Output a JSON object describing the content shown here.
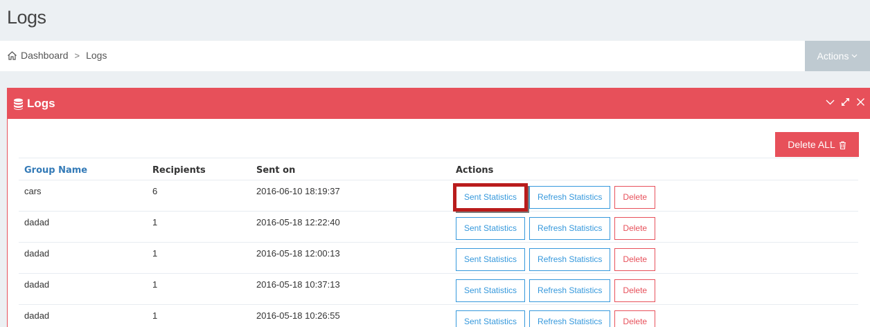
{
  "page": {
    "title": "Logs"
  },
  "breadcrumb": {
    "items": [
      "Dashboard",
      "Logs"
    ],
    "separator": ">"
  },
  "header_actions": {
    "label": "Actions"
  },
  "panel": {
    "title": "Logs",
    "color": "#e7505a"
  },
  "toolbar": {
    "delete_all_label": "Delete ALL"
  },
  "table": {
    "columns": [
      "Group Name",
      "Recipients",
      "Sent on",
      "Actions"
    ],
    "rows": [
      {
        "group": "cars",
        "recipients": "6",
        "sent_on": "2016-06-10 18:19:37"
      },
      {
        "group": "dadad",
        "recipients": "1",
        "sent_on": "2016-05-18 12:22:40"
      },
      {
        "group": "dadad",
        "recipients": "1",
        "sent_on": "2016-05-18 12:00:13"
      },
      {
        "group": "dadad",
        "recipients": "1",
        "sent_on": "2016-05-18 10:37:13"
      },
      {
        "group": "dadad",
        "recipients": "1",
        "sent_on": "2016-05-18 10:26:55"
      }
    ],
    "row_actions": {
      "sent": "Sent Statistics",
      "refresh": "Refresh Statistics",
      "delete": "Delete"
    }
  },
  "colors": {
    "accent": "#e7505a",
    "link": "#3598dc",
    "highlight": "#b91c1c"
  },
  "icons": [
    "home-icon",
    "database-icon",
    "chevron-down-icon",
    "expand-icon",
    "close-icon",
    "trash-icon"
  ]
}
